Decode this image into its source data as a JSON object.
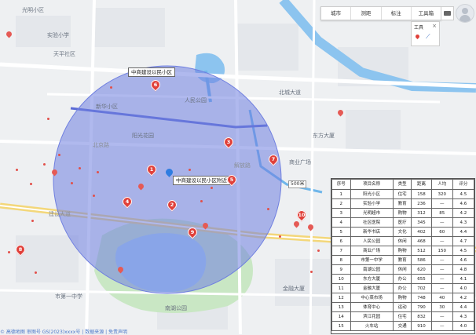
{
  "colors": {
    "radius_fill": "#6f7fe0",
    "marker_red": "#e0403a",
    "water": "#6fb6ea",
    "road_yellow": "#f3d77a"
  },
  "map": {
    "search_label": "中商建设以民小区附近",
    "top_label": "中商建设以民小区",
    "scale_label": "500米",
    "area_labels": [
      "光明小区",
      "实验小学",
      "天平社区",
      "新华小区",
      "阳光花园",
      "人民公园",
      "北城大道",
      "南湖公园",
      "东方大厦",
      "市第一中学",
      "商业广场",
      "金融大厦"
    ],
    "road_labels": [
      "建设大道",
      "北京路",
      "解放路"
    ],
    "markers": [
      "1",
      "2",
      "3",
      "4",
      "5",
      "6",
      "7",
      "8",
      "9",
      "10"
    ],
    "copyright": "© 高德地图 审图号 GS(2023)xxxx号 | 数据来源 | 免责声明"
  },
  "toolbar": {
    "items": [
      "城市",
      "测距",
      "标注",
      "工具箱"
    ]
  },
  "tools_panel": {
    "title": "工具"
  },
  "table": {
    "headers": [
      "序号",
      "项目名称",
      "类型",
      "距离",
      "人均",
      "评分"
    ],
    "rows": [
      [
        "1",
        "阳光小区",
        "住宅",
        "158",
        "320",
        "4.5"
      ],
      [
        "2",
        "实验小学",
        "教育",
        "236",
        "—",
        "4.6"
      ],
      [
        "3",
        "光明超市",
        "购物",
        "312",
        "85",
        "4.2"
      ],
      [
        "4",
        "社区医院",
        "医疗",
        "345",
        "—",
        "4.3"
      ],
      [
        "5",
        "新华书店",
        "文化",
        "402",
        "60",
        "4.4"
      ],
      [
        "6",
        "人民公园",
        "休闲",
        "468",
        "—",
        "4.7"
      ],
      [
        "7",
        "商业广场",
        "购物",
        "512",
        "150",
        "4.5"
      ],
      [
        "8",
        "市第一中学",
        "教育",
        "586",
        "—",
        "4.6"
      ],
      [
        "9",
        "南湖公园",
        "休闲",
        "620",
        "—",
        "4.8"
      ],
      [
        "10",
        "东方大厦",
        "办公",
        "655",
        "—",
        "4.1"
      ],
      [
        "11",
        "金融大厦",
        "办公",
        "702",
        "—",
        "4.0"
      ],
      [
        "12",
        "中心菜市场",
        "购物",
        "748",
        "40",
        "4.2"
      ],
      [
        "13",
        "体育中心",
        "运动",
        "790",
        "30",
        "4.4"
      ],
      [
        "14",
        "滨江花园",
        "住宅",
        "832",
        "—",
        "4.3"
      ],
      [
        "15",
        "火车站",
        "交通",
        "910",
        "—",
        "4.0"
      ]
    ]
  }
}
